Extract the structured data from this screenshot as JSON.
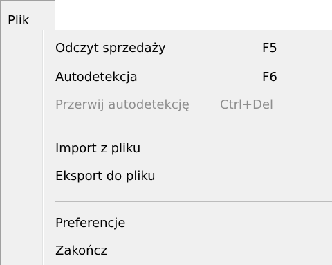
{
  "menubar": {
    "file_label": "Plik"
  },
  "menu": {
    "items": [
      {
        "label": "Odczyt sprzedaży",
        "shortcut": "F5",
        "enabled": true
      },
      {
        "label": "Autodetekcja",
        "shortcut": "F6",
        "enabled": true
      },
      {
        "label": "Przerwij autodetekcję",
        "shortcut": "Ctrl+Del",
        "enabled": false
      },
      {
        "label": "Import z pliku",
        "shortcut": "",
        "enabled": true
      },
      {
        "label": "Eksport do pliku",
        "shortcut": "",
        "enabled": true
      },
      {
        "label": "Preferencje",
        "shortcut": "",
        "enabled": true
      },
      {
        "label": "Zakończ",
        "shortcut": "",
        "enabled": true
      }
    ]
  }
}
